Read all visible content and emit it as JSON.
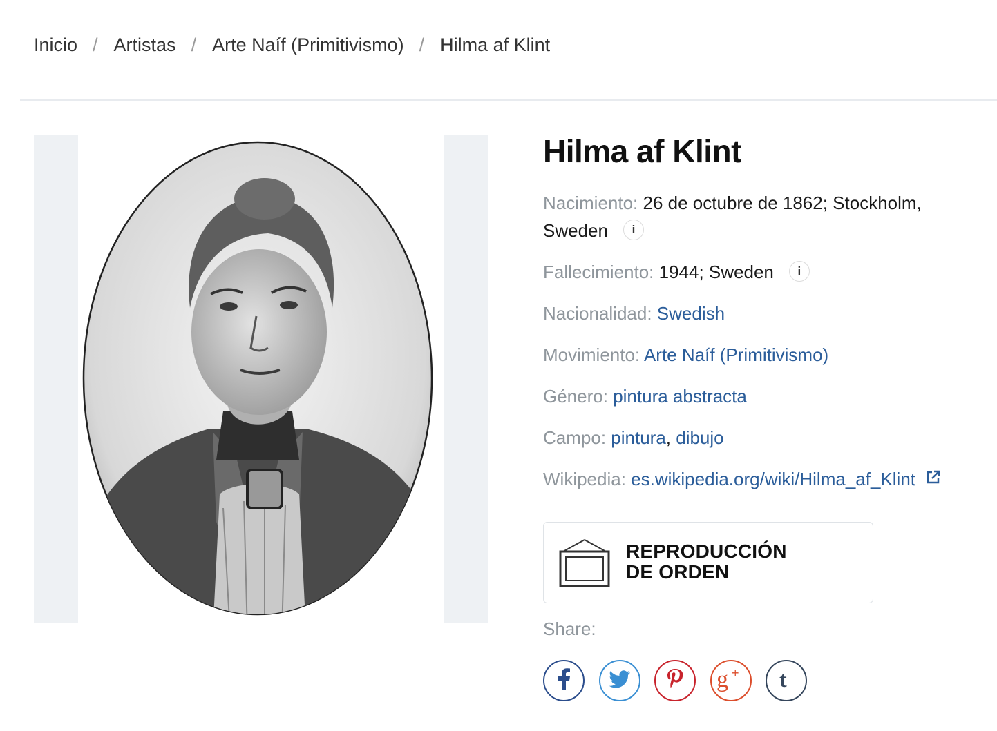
{
  "breadcrumb": {
    "items": [
      "Inicio",
      "Artistas",
      "Arte Naíf (Primitivismo)",
      "Hilma af Klint"
    ],
    "separator": "/"
  },
  "artist": {
    "name": "Hilma af Klint",
    "birth": {
      "label": "Nacimiento:",
      "value_line1": "26 de octubre de 1862; Stockholm,",
      "value_line2": "Sweden"
    },
    "death": {
      "label": "Fallecimiento:",
      "value": "1944; Sweden"
    },
    "nationality": {
      "label": "Nacionalidad:",
      "value": "Swedish"
    },
    "movement": {
      "label": "Movimiento:",
      "value": "Arte Naíf (Primitivismo)"
    },
    "genre": {
      "label": "Género:",
      "value": "pintura abstracta"
    },
    "field": {
      "label": "Campo:",
      "values": [
        "pintura",
        "dibujo"
      ],
      "separator": ", "
    },
    "wikipedia": {
      "label": "Wikipedia:",
      "value": "es.wikipedia.org/wiki/Hilma_af_Klint"
    }
  },
  "order_button": {
    "line1": "REPRODUCCIÓN",
    "line2": "DE ORDEN"
  },
  "share": {
    "label": "Share:",
    "networks": [
      {
        "name": "facebook",
        "icon": "facebook-icon",
        "color": "#2b4d8c"
      },
      {
        "name": "twitter",
        "icon": "twitter-icon",
        "color": "#3a8fd3"
      },
      {
        "name": "pinterest",
        "icon": "pinterest-icon",
        "color": "#c8232c"
      },
      {
        "name": "google-plus",
        "icon": "google-plus-icon",
        "color": "#dc4e2c"
      },
      {
        "name": "tumblr",
        "icon": "tumblr-icon",
        "color": "#35465c"
      }
    ]
  },
  "colors": {
    "link": "#2b5d9a",
    "label": "#8f969c",
    "frame_bg": "#eef1f4"
  }
}
